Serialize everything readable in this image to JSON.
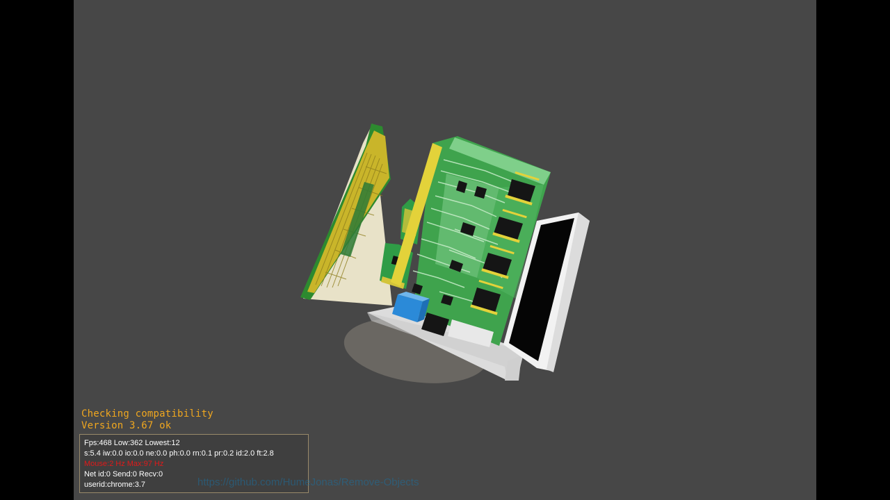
{
  "console": {
    "line1": "Checking compatibility",
    "line2": "Version 3.67 ok"
  },
  "stats": {
    "fps": "Fps:468 Low:362 Lowest:12",
    "timing": "s:5.4 iw:0.0 io:0.0 ne:0.0 ph:0.0 rn:0.1 pr:0.2 id:2.0 ft:2.8",
    "mouse": "Mouse:2 Hz Max:97 Hz",
    "net": "Net id:0 Send:0 Recv:0",
    "user": "userid:chrome:3.7"
  },
  "overlay_url": "https://github.com/HumeJonas/Remove-Objects",
  "colors": {
    "background": "#474747",
    "letterbox": "#000000",
    "console_text": "#f0a71f",
    "stats_text": "#ffffff",
    "stats_warning": "#e01a1a",
    "pcb_green": "#3fa34d",
    "pcb_light_green": "#7fcf8a",
    "gold_contacts": "#e3d23a",
    "chip_black": "#151515",
    "usb_blue": "#2b8ad8",
    "case_white": "#f2f2f2"
  }
}
